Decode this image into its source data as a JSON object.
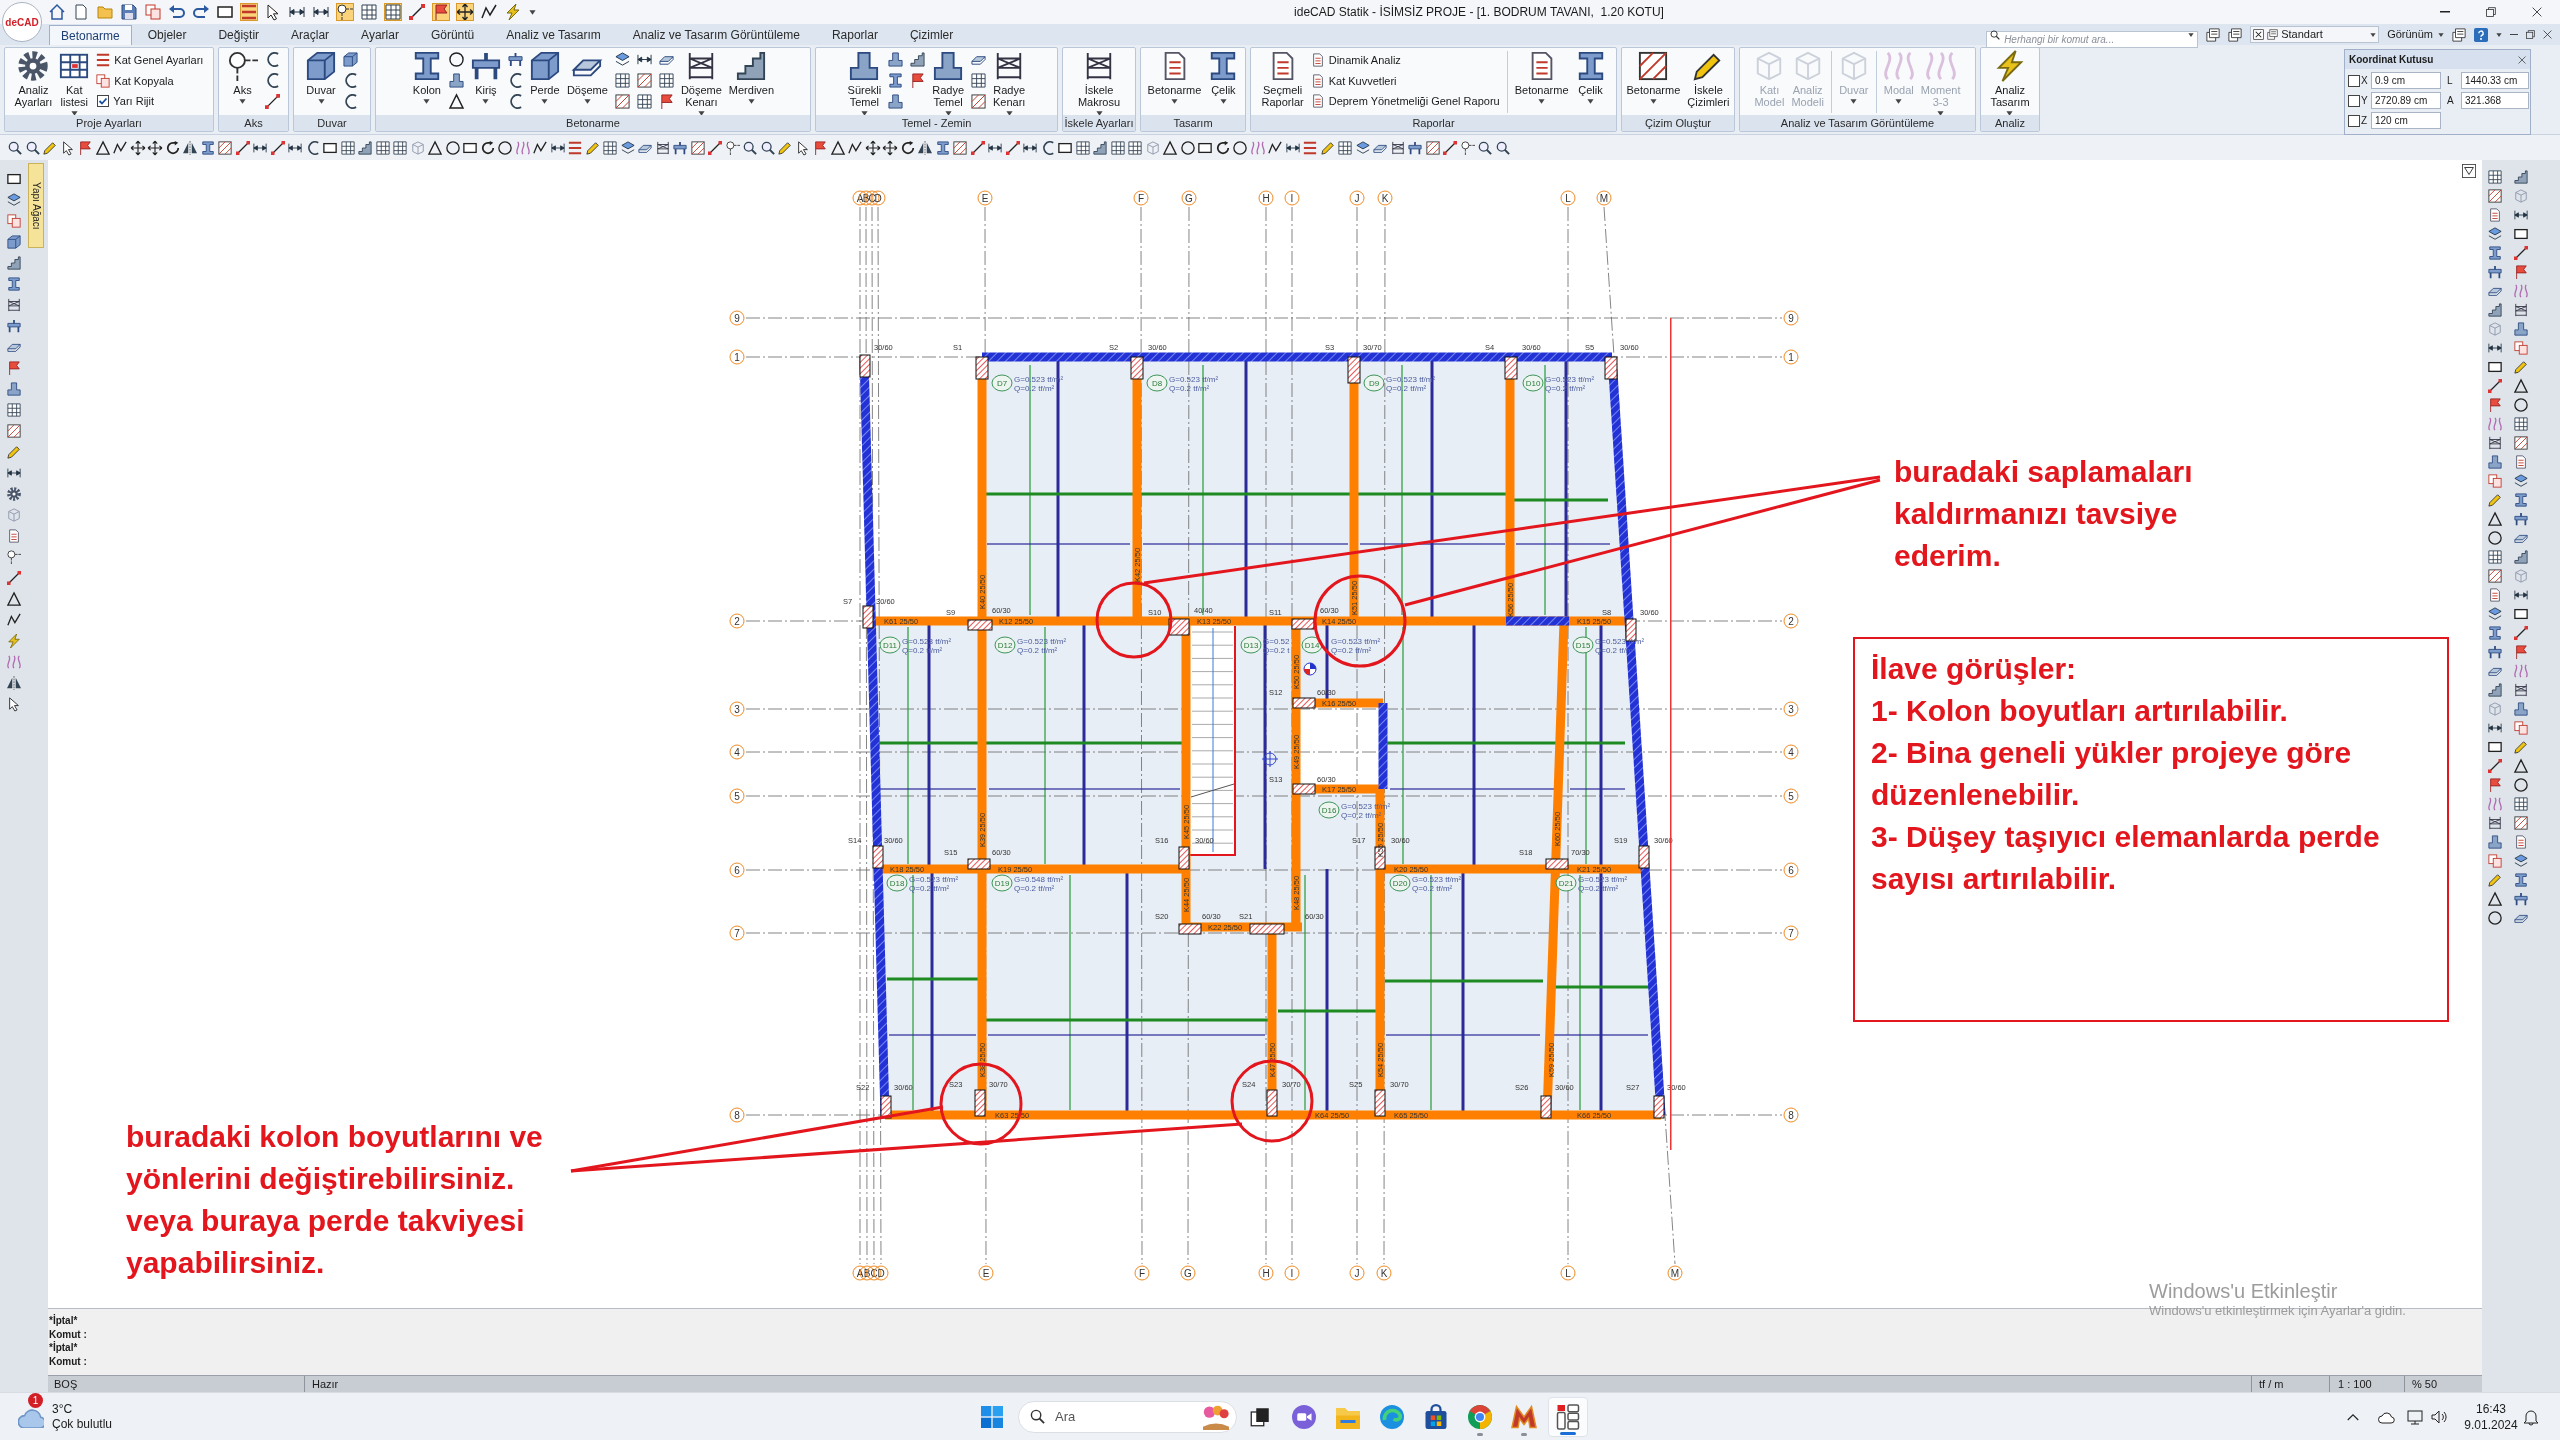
{
  "window": {
    "logo": "deCAD",
    "title": "ideCAD Statik - İSİMSİZ PROJE - [1. BODRUM TAVANI,  1.20 KOTU]"
  },
  "quick_access": [
    {
      "kind": "home",
      "on": false
    },
    {
      "kind": "file",
      "on": false
    },
    {
      "kind": "folder",
      "on": false
    },
    {
      "kind": "save",
      "on": false
    },
    {
      "kind": "copy",
      "on": false
    },
    {
      "kind": "undo",
      "on": false
    },
    {
      "kind": "redo",
      "on": false
    },
    {
      "kind": "rect",
      "on": false
    },
    {
      "kind": "stripes",
      "on": true
    },
    {
      "kind": "arrow",
      "on": false
    },
    {
      "kind": "dim",
      "on": false
    },
    {
      "kind": "dim",
      "on": false
    },
    {
      "kind": "axis",
      "on": true
    },
    {
      "kind": "grid",
      "on": false
    },
    {
      "kind": "grid",
      "on": true
    },
    {
      "kind": "line",
      "on": false
    },
    {
      "kind": "flag",
      "on": true
    },
    {
      "kind": "move",
      "on": true
    },
    {
      "kind": "poly",
      "on": false
    },
    {
      "kind": "bolt",
      "on": false
    }
  ],
  "ribbon": {
    "tabs": [
      {
        "label": "Betonarme",
        "selected": true
      },
      {
        "label": "Objeler",
        "selected": false
      },
      {
        "label": "Değiştir",
        "selected": false
      },
      {
        "label": "Araçlar",
        "selected": false
      },
      {
        "label": "Ayarlar",
        "selected": false
      },
      {
        "label": "Görüntü",
        "selected": false
      },
      {
        "label": "Analiz ve Tasarım",
        "selected": false
      },
      {
        "label": "Analiz ve Tasarım Görüntüleme",
        "selected": false
      },
      {
        "label": "Raporlar",
        "selected": false
      },
      {
        "label": "Çizimler",
        "selected": false
      }
    ],
    "search": {
      "placeholder": "Herhangi bir komut ara..."
    },
    "style_select": {
      "value": "Standart"
    },
    "view_menu": {
      "label": "Görünüm"
    },
    "groups": [
      {
        "title": "Proje Ayarları",
        "items": [
          {
            "kind": "large",
            "label": "Analiz Ayarları"
          },
          {
            "kind": "large",
            "label": "Kat listesi",
            "menu": true
          },
          {
            "kind": "rows",
            "rows": [
              {
                "kind": "small",
                "label": "Kat Genel Ayarları"
              },
              {
                "kind": "small",
                "label": "Kat Kopyala"
              },
              {
                "kind": "check",
                "label": "Yarı Rijit",
                "checked": true
              }
            ]
          }
        ]
      },
      {
        "title": "Aks",
        "items": [
          {
            "kind": "large",
            "label": "Aks",
            "menu": true
          },
          {
            "kind": "icons"
          }
        ]
      },
      {
        "title": "Duvar",
        "items": [
          {
            "kind": "large",
            "label": "Duvar",
            "menu": true
          },
          {
            "kind": "icons"
          }
        ]
      },
      {
        "title": "Betonarme",
        "items": [
          {
            "kind": "large",
            "label": "Kolon",
            "menu": true
          },
          {
            "kind": "icons"
          },
          {
            "kind": "large",
            "label": "Kiriş",
            "menu": true
          },
          {
            "kind": "icons"
          },
          {
            "kind": "large",
            "label": "Perde",
            "menu": true
          },
          {
            "kind": "large",
            "label": "Döşeme",
            "menu": true
          },
          {
            "kind": "icons"
          },
          {
            "kind": "icons"
          },
          {
            "kind": "icons"
          },
          {
            "kind": "large",
            "label": "Döşeme Kenarı",
            "menu": true
          },
          {
            "kind": "large",
            "label": "Merdiven",
            "menu": true
          }
        ]
      },
      {
        "title": "Temel - Zemin",
        "items": [
          {
            "kind": "large",
            "label": "Sürekli Temel",
            "menu": true
          },
          {
            "kind": "icons"
          },
          {
            "kind": "icons"
          },
          {
            "kind": "large",
            "label": "Radye Temel",
            "menu": true
          },
          {
            "kind": "icons"
          },
          {
            "kind": "large",
            "label": "Radye Kenarı",
            "menu": true
          }
        ]
      },
      {
        "title": "İskele Ayarları",
        "items": [
          {
            "kind": "large",
            "label": "İskele Makrosu",
            "menu": true
          }
        ]
      },
      {
        "title": "Tasarım",
        "items": [
          {
            "kind": "large",
            "label": "Betonarme",
            "menu": true
          },
          {
            "kind": "large",
            "label": "Çelik",
            "menu": true
          }
        ]
      },
      {
        "title": "Raporlar",
        "items": [
          {
            "kind": "large",
            "label": "Seçmeli Raporlar"
          },
          {
            "kind": "rows",
            "rows": [
              {
                "kind": "small",
                "label": "Dinamik Analiz"
              },
              {
                "kind": "small",
                "label": "Kat Kuvvetleri"
              },
              {
                "kind": "small",
                "label": "Deprem Yönetmeliği Genel Raporu"
              }
            ]
          },
          {
            "kind": "separator"
          },
          {
            "kind": "large",
            "label": "Betonarme",
            "menu": true
          },
          {
            "kind": "large",
            "label": "Çelik",
            "menu": true
          }
        ]
      },
      {
        "title": "Çizim Oluştur",
        "items": [
          {
            "kind": "large",
            "label": "Betonarme",
            "menu": true
          },
          {
            "kind": "large",
            "label": "İskele Çizimleri"
          }
        ]
      },
      {
        "title": "Analiz ve Tasarım Görüntüleme",
        "items": [
          {
            "kind": "large",
            "label": "Katı Model",
            "disabled": true
          },
          {
            "kind": "large",
            "label": "Analiz Modeli",
            "disabled": true
          },
          {
            "kind": "separator"
          },
          {
            "kind": "large",
            "label": "Duvar",
            "menu": true,
            "disabled": true
          },
          {
            "kind": "separator"
          },
          {
            "kind": "large",
            "label": "Modal",
            "menu": true,
            "disabled": true
          },
          {
            "kind": "large",
            "label": "Moment 3-3",
            "menu": true,
            "disabled": true
          }
        ]
      },
      {
        "title": "Analiz",
        "items": [
          {
            "kind": "large",
            "label": "Analiz Tasarım",
            "menu": true
          }
        ]
      }
    ]
  },
  "coordinate_box": {
    "title": "Koordinat Kutusu",
    "fields": [
      {
        "kind": "check",
        "label": "X",
        "checked": false
      },
      {
        "kind": "value",
        "value": "0.9 cm"
      },
      {
        "kind": "label",
        "label": "L"
      },
      {
        "kind": "value",
        "value": "1440.33 cm"
      },
      {
        "kind": "check",
        "label": "Y",
        "checked": false
      },
      {
        "kind": "value",
        "value": "2720.89 cm"
      },
      {
        "kind": "label",
        "label": "A"
      },
      {
        "kind": "value",
        "value": "321.368"
      },
      {
        "kind": "check",
        "label": "Z",
        "checked": false
      },
      {
        "kind": "value",
        "value": "120 cm"
      }
    ]
  },
  "structure_tab": {
    "label": "Yapı Ağacı"
  },
  "grid": {
    "top_labels": [
      "A",
      "B",
      "C",
      "D",
      "E",
      "F",
      "G",
      "H",
      "I",
      "J",
      "K",
      "L",
      "M"
    ],
    "bottom_labels": [
      "A",
      "B",
      "C",
      "D",
      "E",
      "F",
      "G",
      "H",
      "I",
      "J",
      "K",
      "L",
      "M"
    ],
    "left_labels": [
      "9",
      "1",
      "2",
      "3",
      "4",
      "5",
      "6",
      "7",
      "8"
    ],
    "right_labels": [
      "9",
      "1",
      "2",
      "3",
      "4",
      "5",
      "6",
      "7",
      "8"
    ]
  },
  "slabs": [
    {
      "id": "D7",
      "dead_load": "G=0.523 tf/m²",
      "live_load": "Q=0.2 tf/m²"
    },
    {
      "id": "D8",
      "dead_load": "G=0.523 tf/m²",
      "live_load": "Q=0.2 tf/m²"
    },
    {
      "id": "D9",
      "dead_load": "G=0.523 tf/m²",
      "live_load": "Q=0.2 tf/m²"
    },
    {
      "id": "D10",
      "dead_load": "G=0.523 tf/m²",
      "live_load": "Q=0.2 tf/m²"
    },
    {
      "id": "D11",
      "dead_load": "G=0.523 tf/m²",
      "live_load": "Q=0.2 tf/m²"
    },
    {
      "id": "D12",
      "dead_load": "G=0.523 tf/m²",
      "live_load": "Q=0.2 tf/m²"
    },
    {
      "id": "D13",
      "dead_load": "G=0.52",
      "live_load": "Q=0.2 t"
    },
    {
      "id": "D14",
      "dead_load": "G=0.523 tf/m²",
      "live_load": "Q=0.2 tf/m²"
    },
    {
      "id": "D15",
      "dead_load": "G=0.523 tf/m²",
      "live_load": "Q=0.2 tf/m²"
    },
    {
      "id": "D16",
      "dead_load": "G=0.523 tf/m²",
      "live_load": "Q=0.2 tf/m²"
    },
    {
      "id": "D18",
      "dead_load": "G=0.523 tf/m²",
      "live_load": "Q=0.2 tf/m²"
    },
    {
      "id": "D19",
      "dead_load": "G=0.548 tf/m²",
      "live_load": "Q=0.2 tf/m²"
    },
    {
      "id": "D20",
      "dead_load": "G=0.523 tf/m²",
      "live_load": "Q=0.2 tf/m²"
    },
    {
      "id": "D21",
      "dead_load": "G=0.523 tf/m²",
      "live_load": "Q=0.2 tf/m²"
    }
  ],
  "beam_labels": [
    "K61 25/50",
    "K12 25/50",
    "K13 25/50",
    "K14 25/50",
    "K15 25/50",
    "K16 25/50",
    "K17 25/50",
    "K18 25/50",
    "K19 25/50",
    "K20 25/50",
    "K21 25/50",
    "K22 25/50",
    "K63 25/50",
    "K64 25/50",
    "K65 25/50",
    "K66 25/50",
    "K40 25/50",
    "K42 25/50",
    "K51 25/50",
    "K56 25/50",
    "K39 25/50",
    "K45 25/50",
    "K50 25/50",
    "K49 25/50",
    "K55 25/50",
    "K60 25/50",
    "K44 25/50",
    "K48 25/50",
    "K38 25/50",
    "K47 25/50",
    "K54 25/50",
    "K59 25/50"
  ],
  "columns": [
    {
      "size": "30/60"
    },
    {
      "name": "S1"
    },
    {
      "name": "S2",
      "size": "30/60"
    },
    {
      "name": "S3",
      "size": "30/70"
    },
    {
      "name": "S4",
      "size": "30/60"
    },
    {
      "name": "S5",
      "size": "30/60"
    },
    {
      "name": "S7",
      "size": "30/60"
    },
    {
      "name": "S9",
      "size": "60/30"
    },
    {
      "name": "S10",
      "size": "40/40"
    },
    {
      "name": "S11",
      "size": "60/30"
    },
    {
      "name": "S8",
      "size": "30/60"
    },
    {
      "name": "S12",
      "size": "60/30"
    },
    {
      "name": "S13",
      "size": "60/30"
    },
    {
      "name": "S14",
      "size": "30/60"
    },
    {
      "name": "S15",
      "size": "60/30"
    },
    {
      "name": "S16",
      "size": "30/60"
    },
    {
      "name": "S17",
      "size": "30/60"
    },
    {
      "name": "S18",
      "size": "70/30"
    },
    {
      "name": "S19",
      "size": "30/60"
    },
    {
      "name": "S20",
      "size": "60/30"
    },
    {
      "name": "S21",
      "size": "60/30"
    },
    {
      "name": "S22",
      "size": "30/60"
    },
    {
      "name": "S23",
      "size": "30/70"
    },
    {
      "name": "S24",
      "size": "30/70"
    },
    {
      "name": "S25",
      "size": "30/70"
    },
    {
      "name": "S26",
      "size": "30/60"
    },
    {
      "name": "S27",
      "size": "30/60"
    }
  ],
  "annotations": {
    "top_note": "buradaki saplamaları kaldırmanızı tavsiye ederim.",
    "review_box": {
      "title": "İlave görüşler:",
      "items": [
        "1- Kolon boyutları artırılabilir.",
        "2- Bina geneli yükler projeye göre düzenlenebilir.",
        "3- Düşey taşıyıcı elemanlarda perde sayısı artırılabilir."
      ]
    },
    "bottom_note": "buradaki kolon boyutlarını ve yönlerini değiştirebilirsiniz. veya buraya perde takviyesi yapabilirsiniz."
  },
  "activation_notice": {
    "title": "Windows'u Etkinleştir",
    "text": "Windows'u etkinleştirmek için Ayarlar'a gidin."
  },
  "command_log": [
    "*İptal*",
    "Komut :",
    "*İptal*",
    "Komut :"
  ],
  "status_bar": {
    "layer": "BOŞ",
    "message": "Hazır",
    "units": "tf / m",
    "scale": "1 : 100",
    "zoom": "% 50"
  },
  "taskbar": {
    "weather": {
      "temperature": "3°C",
      "condition": "Çok bulutlu",
      "badge": "1"
    },
    "search": {
      "placeholder": "Ara"
    },
    "apps": [
      {
        "kind": "chat",
        "running": false,
        "active": false
      },
      {
        "kind": "explorer",
        "running": false,
        "active": false
      },
      {
        "kind": "edge",
        "running": false,
        "active": false
      },
      {
        "kind": "store",
        "running": false,
        "active": false
      },
      {
        "kind": "chrome",
        "running": true,
        "active": false
      },
      {
        "kind": "game",
        "running": true,
        "active": false
      },
      {
        "kind": "idecad",
        "running": true,
        "active": true
      }
    ],
    "clock": {
      "time": "16:43",
      "date": "9.01.2024"
    }
  }
}
